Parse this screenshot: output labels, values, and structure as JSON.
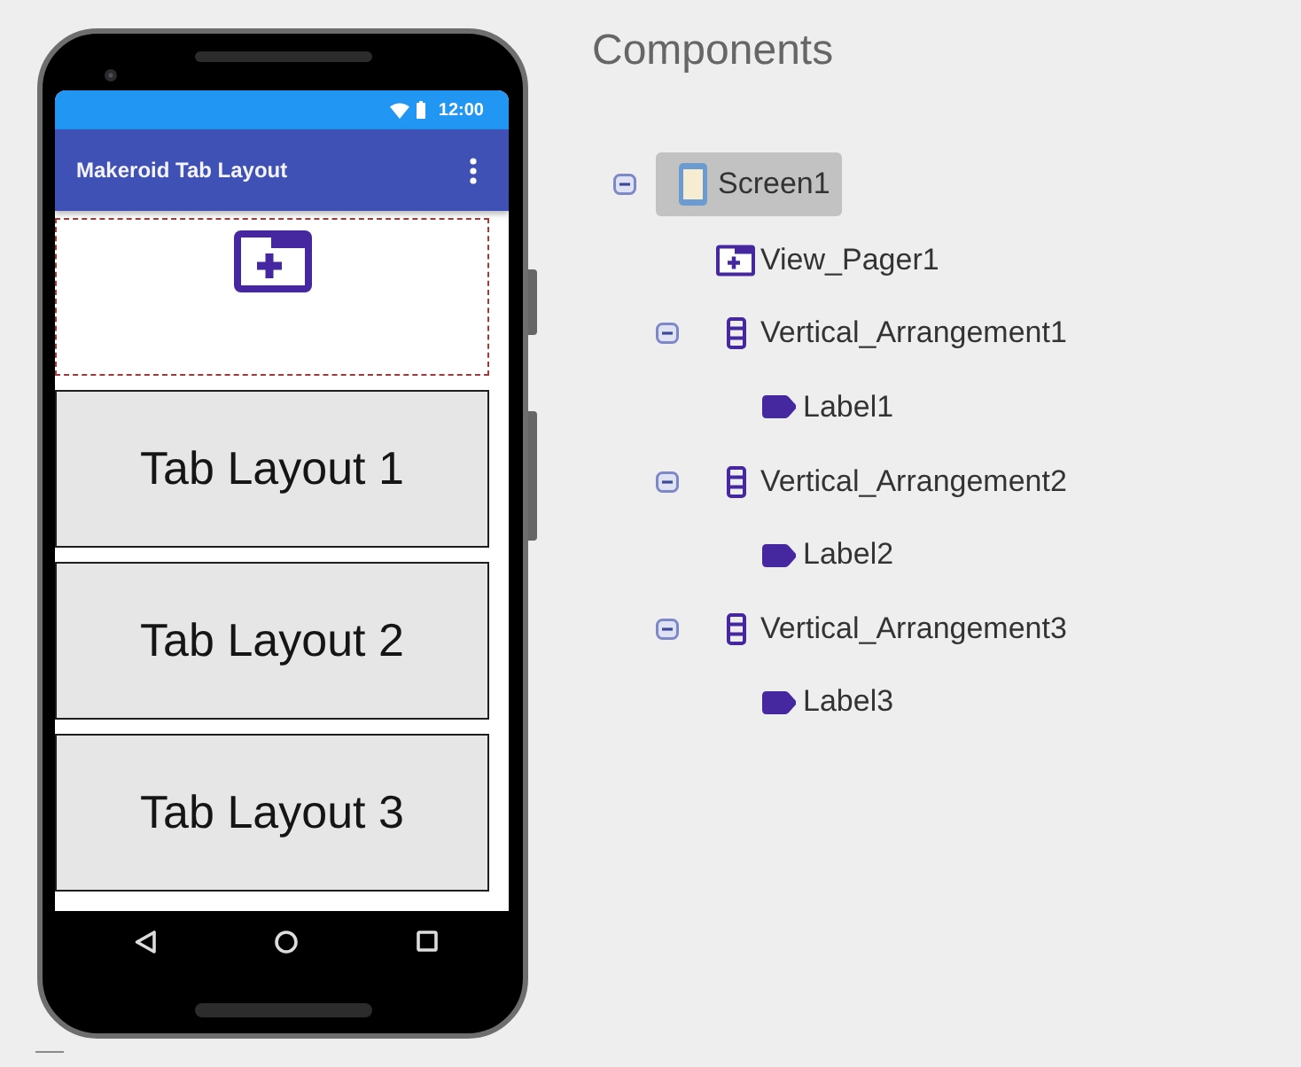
{
  "phone": {
    "status_bar": {
      "time": "12:00"
    },
    "app_bar": {
      "title": "Makeroid Tab Layout"
    },
    "pages": [
      "Tab Layout 1",
      "Tab Layout 2",
      "Tab Layout 3"
    ]
  },
  "components": {
    "title": "Components",
    "tree": [
      {
        "name": "Screen1",
        "kind": "screen",
        "selected": true,
        "expanded": true,
        "children": [
          {
            "name": "View_Pager1",
            "kind": "view_pager",
            "selected": false
          },
          {
            "name": "Vertical_Arrangement1",
            "kind": "vertical_arrangement",
            "selected": false,
            "expanded": true,
            "children": [
              {
                "name": "Label1",
                "kind": "label",
                "selected": false
              }
            ]
          },
          {
            "name": "Vertical_Arrangement2",
            "kind": "vertical_arrangement",
            "selected": false,
            "expanded": true,
            "children": [
              {
                "name": "Label2",
                "kind": "label",
                "selected": false
              }
            ]
          },
          {
            "name": "Vertical_Arrangement3",
            "kind": "vertical_arrangement",
            "selected": false,
            "expanded": true,
            "children": [
              {
                "name": "Label3",
                "kind": "label",
                "selected": false
              }
            ]
          }
        ]
      }
    ]
  }
}
